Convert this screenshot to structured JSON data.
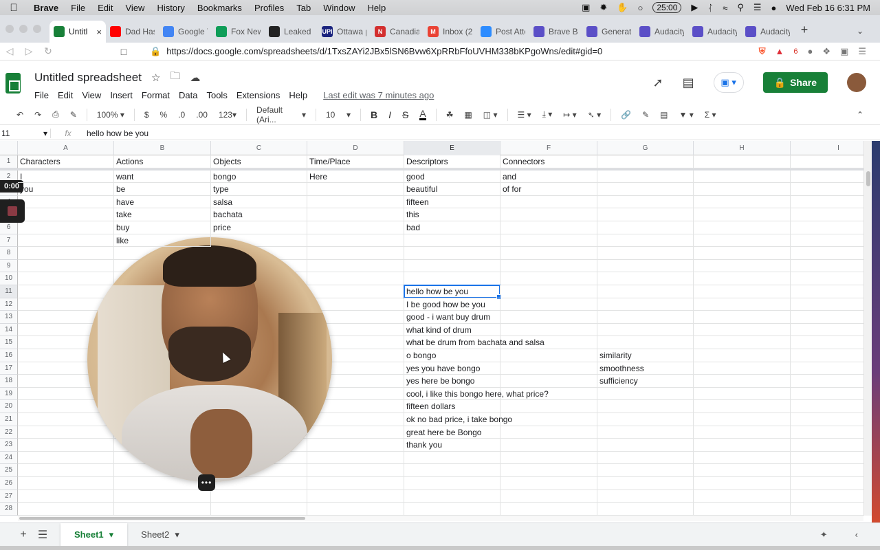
{
  "menubar": {
    "app": "Brave",
    "items": [
      "File",
      "Edit",
      "View",
      "History",
      "Bookmarks",
      "Profiles",
      "Tab",
      "Window",
      "Help"
    ],
    "timer": "25:00",
    "clock": "Wed Feb 16  6:31 PM"
  },
  "tabs": [
    {
      "title": "Untitl",
      "color": "#188038",
      "active": true
    },
    {
      "title": "Dad Has",
      "color": "#ff0000"
    },
    {
      "title": "Google T",
      "color": "#4285f4"
    },
    {
      "title": "Fox New",
      "color": "#0f9d58"
    },
    {
      "title": "Leaked c",
      "color": "#222222"
    },
    {
      "title": "Ottawa p",
      "color": "#1a237e",
      "badge": "UPI"
    },
    {
      "title": "Canadiar",
      "color": "#d32f2f",
      "badge": "N"
    },
    {
      "title": "Inbox (2",
      "color": "#ea4335",
      "badge": "M"
    },
    {
      "title": "Post Atte",
      "color": "#2d8cff"
    },
    {
      "title": "Brave Br",
      "color": "#5b4fc7"
    },
    {
      "title": "Generate",
      "color": "#5b4fc7"
    },
    {
      "title": "Audacity",
      "color": "#5b4fc7"
    },
    {
      "title": "Audacity",
      "color": "#5b4fc7"
    },
    {
      "title": "Audacity",
      "color": "#5b4fc7"
    }
  ],
  "address": {
    "url": "https://docs.google.com/spreadsheets/d/1TxsZAYi2JBx5lSN6Bvw6XpRRbFfoUVHM338bKPgoWns/edit#gid=0",
    "ext_badge": "6"
  },
  "sheets": {
    "title": "Untitled spreadsheet",
    "menus": [
      "File",
      "Edit",
      "View",
      "Insert",
      "Format",
      "Data",
      "Tools",
      "Extensions",
      "Help"
    ],
    "last_edit": "Last edit was 7 minutes ago",
    "share_label": "Share"
  },
  "toolbar": {
    "zoom": "100%",
    "currency": "$",
    "percent": "%",
    "dec_less": ".0",
    "dec_more": ".00",
    "format_more": "123",
    "font": "Default (Ari...",
    "size": "10"
  },
  "formula_bar": {
    "name_box": "11",
    "fx": "fx",
    "value": "hello how be you"
  },
  "grid": {
    "columns": [
      "A",
      "B",
      "C",
      "D",
      "E",
      "F",
      "G",
      "H",
      "I"
    ],
    "rows": [
      "1",
      "2",
      "3",
      "4",
      "5",
      "6",
      "7",
      "8",
      "9",
      "10",
      "11",
      "12",
      "13",
      "14",
      "15",
      "16",
      "17",
      "18",
      "19",
      "20",
      "21",
      "22",
      "23",
      "24",
      "25",
      "26",
      "27",
      "28"
    ],
    "cells": [
      {
        "r": 1,
        "c": 0,
        "v": "Characters"
      },
      {
        "r": 1,
        "c": 1,
        "v": "Actions"
      },
      {
        "r": 1,
        "c": 2,
        "v": "Objects"
      },
      {
        "r": 1,
        "c": 3,
        "v": "Time/Place"
      },
      {
        "r": 1,
        "c": 4,
        "v": "Descriptors"
      },
      {
        "r": 1,
        "c": 5,
        "v": "Connectors"
      },
      {
        "r": 2,
        "c": 0,
        "v": "I"
      },
      {
        "r": 2,
        "c": 1,
        "v": "want"
      },
      {
        "r": 2,
        "c": 2,
        "v": "bongo"
      },
      {
        "r": 2,
        "c": 3,
        "v": "Here"
      },
      {
        "r": 2,
        "c": 4,
        "v": "good"
      },
      {
        "r": 2,
        "c": 5,
        "v": "and"
      },
      {
        "r": 3,
        "c": 0,
        "v": "you"
      },
      {
        "r": 3,
        "c": 1,
        "v": "be"
      },
      {
        "r": 3,
        "c": 2,
        "v": "type"
      },
      {
        "r": 3,
        "c": 4,
        "v": "beautiful"
      },
      {
        "r": 3,
        "c": 5,
        "v": "of for"
      },
      {
        "r": 4,
        "c": 1,
        "v": "have"
      },
      {
        "r": 4,
        "c": 2,
        "v": "salsa"
      },
      {
        "r": 4,
        "c": 4,
        "v": "fifteen"
      },
      {
        "r": 5,
        "c": 1,
        "v": "take"
      },
      {
        "r": 5,
        "c": 2,
        "v": "bachata"
      },
      {
        "r": 5,
        "c": 4,
        "v": "this"
      },
      {
        "r": 6,
        "c": 1,
        "v": "buy"
      },
      {
        "r": 6,
        "c": 2,
        "v": "price"
      },
      {
        "r": 6,
        "c": 4,
        "v": "bad"
      },
      {
        "r": 7,
        "c": 1,
        "v": "like"
      },
      {
        "r": 11,
        "c": 4,
        "v": "hello how be you"
      },
      {
        "r": 12,
        "c": 4,
        "v": "I be good how be you"
      },
      {
        "r": 13,
        "c": 4,
        "v": "good - i want buy drum"
      },
      {
        "r": 14,
        "c": 4,
        "v": "what kind of drum"
      },
      {
        "r": 15,
        "c": 4,
        "v": "what be drum from bachata and salsa"
      },
      {
        "r": 16,
        "c": 4,
        "v": "o bongo"
      },
      {
        "r": 16,
        "c": 6,
        "v": "similarity"
      },
      {
        "r": 17,
        "c": 4,
        "v": "yes you have bongo"
      },
      {
        "r": 17,
        "c": 6,
        "v": "smoothness"
      },
      {
        "r": 18,
        "c": 4,
        "v": "yes here be bongo"
      },
      {
        "r": 18,
        "c": 6,
        "v": "sufficiency"
      },
      {
        "r": 19,
        "c": 4,
        "v": "cool, i like this bongo here, what price?"
      },
      {
        "r": 20,
        "c": 4,
        "v": "fifteen dollars"
      },
      {
        "r": 21,
        "c": 4,
        "v": "ok no bad price, i take bongo"
      },
      {
        "r": 22,
        "c": 4,
        "v": "great here be Bongo"
      },
      {
        "r": 23,
        "c": 4,
        "v": "thank you"
      }
    ]
  },
  "sheet_tabs": [
    {
      "label": "Sheet1",
      "active": true
    },
    {
      "label": "Sheet2",
      "active": false
    }
  ],
  "recording": {
    "elapsed": "0:00"
  },
  "colors": {
    "sheets_green": "#188038",
    "selection_blue": "#1a73e8"
  }
}
